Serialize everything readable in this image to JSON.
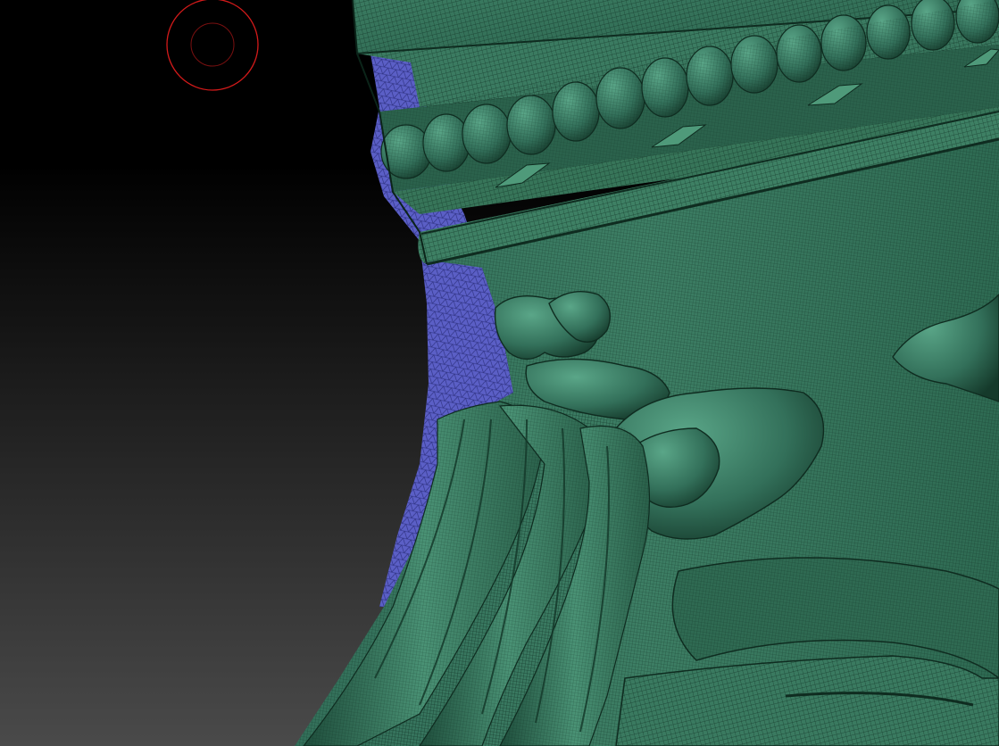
{
  "viewport": {
    "background_top_color": "#000000",
    "background_bottom_color": "#4a4a4a"
  },
  "model": {
    "surface_color": "#2f6a52",
    "surface_highlight_color": "#4f9a7a",
    "surface_shadow_color": "#14382a",
    "wireframe_color": "#0d2a1e",
    "masked_region_color": "#5b5fc6",
    "masked_wire_color": "#2a2d7a"
  },
  "brush": {
    "outer_ring_color": "#d41a1a",
    "inner_ring_color": "#7a1010"
  }
}
